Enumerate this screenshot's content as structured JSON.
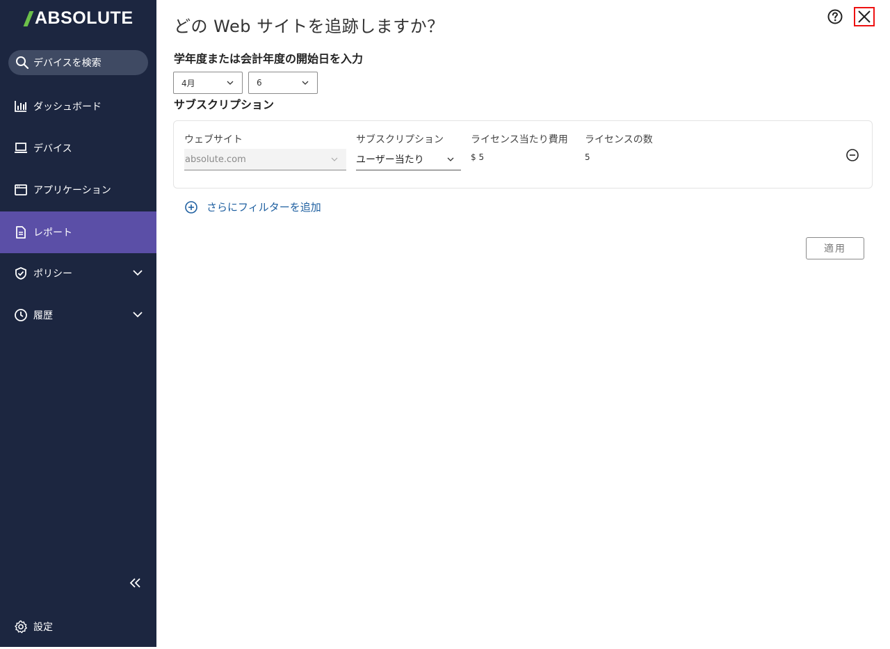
{
  "sidebar": {
    "logo_text": "ABSOLUTE",
    "search": {
      "label": "デバイスを検索"
    },
    "items": [
      {
        "label": "ダッシュボード",
        "icon": "bar-chart-icon",
        "active": false
      },
      {
        "label": "デバイス",
        "icon": "laptop-icon",
        "active": false
      },
      {
        "label": "アプリケーション",
        "icon": "app-window-icon",
        "active": false
      },
      {
        "label": "レポート",
        "icon": "document-icon",
        "active": true
      },
      {
        "label": "ポリシー",
        "icon": "shield-check-icon",
        "active": false,
        "expandable": true
      },
      {
        "label": "履歴",
        "icon": "clock-icon",
        "active": false,
        "expandable": true
      }
    ],
    "settings_label": "設定"
  },
  "header": {
    "title": "どの Web サイトを追跡しますか？"
  },
  "fiscal": {
    "label": "学年度または会計年度の開始日を入力",
    "month": "4月",
    "day": "6"
  },
  "subscriptions": {
    "label": "サブスクリプション",
    "columns": {
      "website": "ウェブサイト",
      "subscription": "サブスクリプション",
      "cost": "ライセンス当たり費用",
      "count": "ライセンスの数"
    },
    "row": {
      "website": "absolute.com",
      "subscription": "ユーザー当たり",
      "cost": "$ 5",
      "count": "5"
    }
  },
  "add_filter_label": "さらにフィルターを追加",
  "apply_label": "適用",
  "colors": {
    "sidebar_bg": "#1c2640",
    "active_item": "#5b4fa7",
    "accent_green": "#6cc04a",
    "link_blue": "#1e5fa0",
    "close_border": "#e11111"
  }
}
